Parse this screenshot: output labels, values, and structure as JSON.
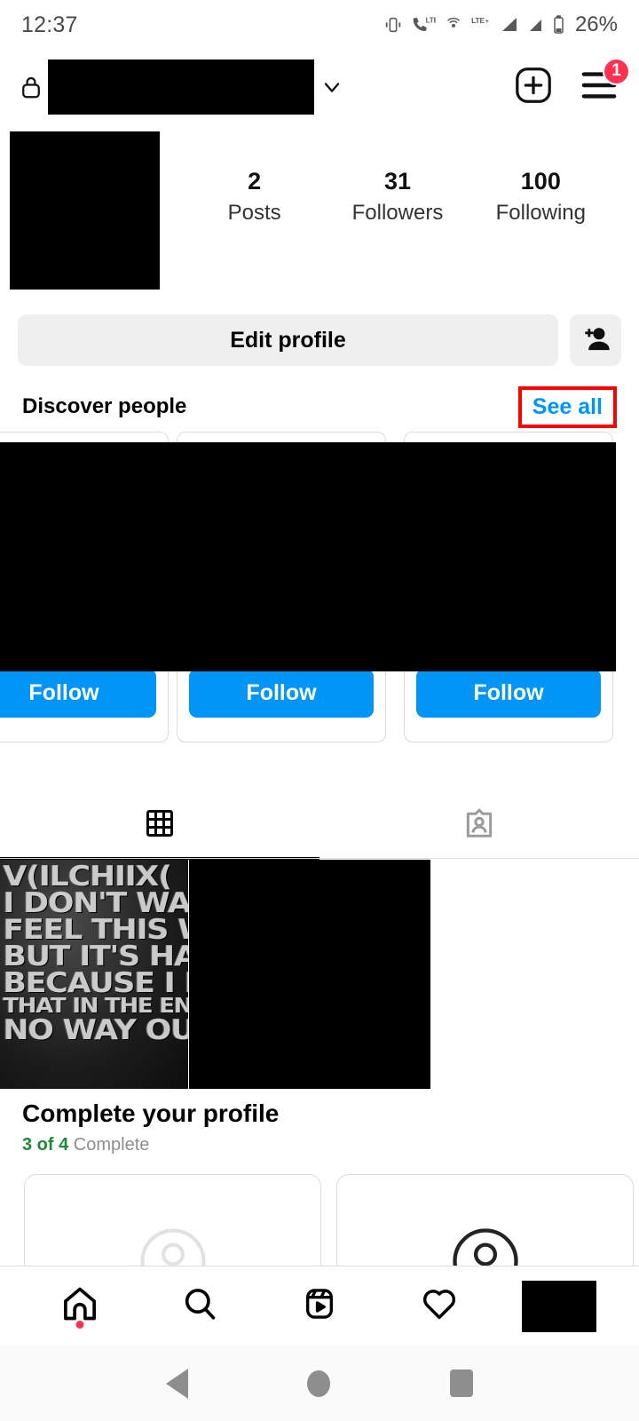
{
  "status_bar": {
    "time": "12:37",
    "battery": "26%",
    "icons": [
      "vibrate-icon",
      "lte-call-icon",
      "hotspot-icon",
      "lte-plus-icon",
      "signal-bars-icon",
      "battery-icon"
    ]
  },
  "app_header": {
    "lock_icon": "lock-icon",
    "username": "",
    "chevron_icon": "chevron-down-icon",
    "add_icon": "plus-square-icon",
    "menu_icon": "hamburger-menu-icon",
    "menu_badge": "1"
  },
  "profile": {
    "avatar": "",
    "stats": [
      {
        "value": "2",
        "label": "Posts"
      },
      {
        "value": "31",
        "label": "Followers"
      },
      {
        "value": "100",
        "label": "Following"
      }
    ]
  },
  "actions": {
    "edit_profile_label": "Edit profile",
    "add_user_icon": "add-person-icon"
  },
  "discover": {
    "title": "Discover people",
    "see_all_label": "See all",
    "highlight_color": "#FF0000",
    "accent_color": "#0095F6",
    "cards": [
      {
        "follow_label": "Follow"
      },
      {
        "follow_label": "Follow"
      },
      {
        "follow_label": "Follow"
      }
    ]
  },
  "tabs": [
    {
      "name": "grid-tab",
      "icon": "grid-icon",
      "active": true
    },
    {
      "name": "tagged-tab",
      "icon": "person-card-icon",
      "active": false
    }
  ],
  "posts": {
    "lyric_lines": [
      "V(ILCHIIX(",
      "I DON'T WANT T",
      "FEEL THIS WA",
      "BUT IT'S HARI",
      "BECAUSE I KNO",
      "THAT IN THE END THERE",
      "NO WAY OU"
    ]
  },
  "complete_profile": {
    "title": "Complete your profile",
    "count": "3 of 4",
    "status": " Complete",
    "count_color": "#1D8A36",
    "cards": [
      {
        "icon": "avatar-placeholder-icon"
      },
      {
        "icon": "avatar-outline-icon"
      }
    ]
  },
  "bottom_nav": [
    {
      "name": "home-tab",
      "icon": "home-icon",
      "badge_dot": true
    },
    {
      "name": "search-tab",
      "icon": "search-icon",
      "badge_dot": false
    },
    {
      "name": "reels-tab",
      "icon": "reels-icon",
      "badge_dot": false
    },
    {
      "name": "activity-tab",
      "icon": "heart-icon",
      "badge_dot": false
    },
    {
      "name": "profile-tab",
      "icon": "avatar-icon",
      "badge_dot": false
    }
  ],
  "android_nav": {
    "back": "back-triangle-icon",
    "home": "home-circle-icon",
    "recents": "recents-square-icon"
  }
}
